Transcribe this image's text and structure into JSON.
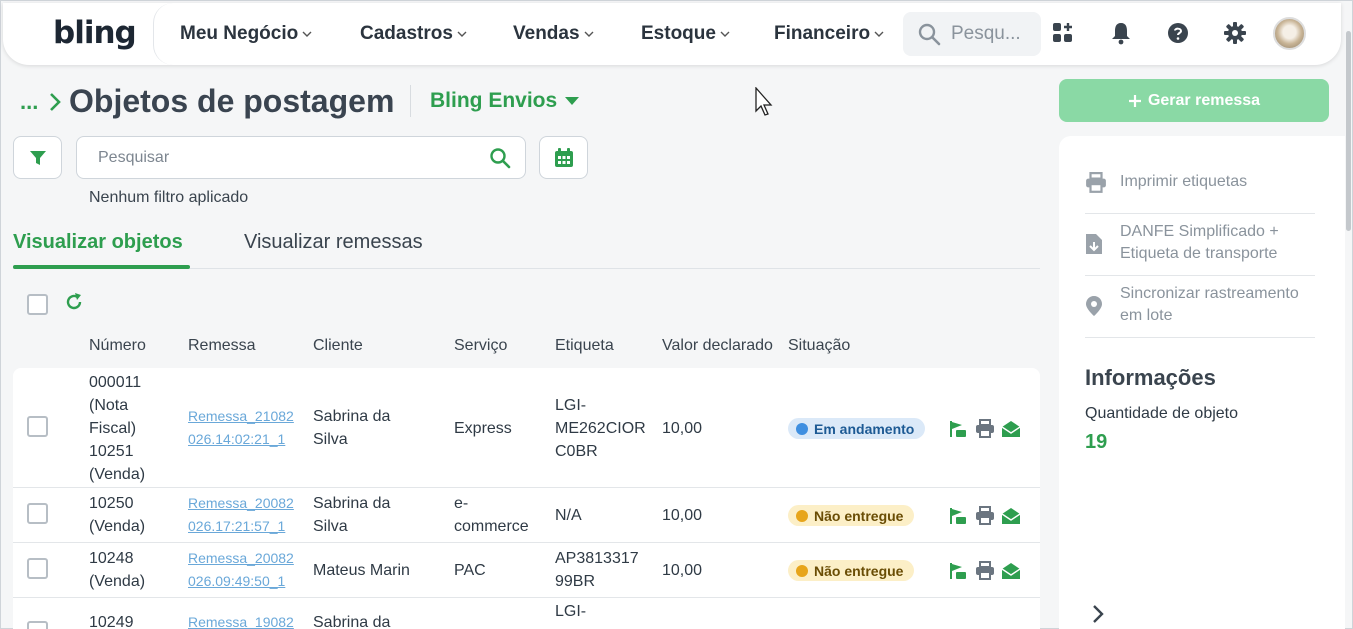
{
  "nav": {
    "logo": "bling",
    "items": [
      "Meu Negócio",
      "Cadastros",
      "Vendas",
      "Estoque",
      "Financeiro"
    ],
    "search_placeholder": "Pesqu..."
  },
  "header": {
    "breadcrumb": "...",
    "title": "Objetos de postagem",
    "module": "Bling Envios"
  },
  "filters": {
    "search_placeholder": "Pesquisar",
    "status": "Nenhum filtro aplicado"
  },
  "tabs": [
    "Visualizar objetos",
    "Visualizar remessas"
  ],
  "table": {
    "columns": [
      "Número",
      "Remessa",
      "Cliente",
      "Serviço",
      "Etiqueta",
      "Valor declarado",
      "Situação"
    ],
    "rows": [
      {
        "numero": [
          "000011",
          "(Nota",
          "Fiscal)",
          "10251",
          "(Venda)"
        ],
        "remessa": [
          "Remessa_21082",
          "026.14:02:21_1"
        ],
        "cliente": [
          "Sabrina da",
          "Silva"
        ],
        "servico": [
          "Express"
        ],
        "etiqueta": [
          "LGI-",
          "ME262CIOR",
          "C0BR"
        ],
        "valor": "10,00",
        "situacao": "Em andamento"
      },
      {
        "numero": [
          "10250",
          "(Venda)"
        ],
        "remessa": [
          "Remessa_20082",
          "026.17:21:57_1"
        ],
        "cliente": [
          "Sabrina da",
          "Silva"
        ],
        "servico": [
          "e-",
          "commerce"
        ],
        "etiqueta": [
          "N/A"
        ],
        "valor": "10,00",
        "situacao": "Não entregue"
      },
      {
        "numero": [
          "10248",
          "(Venda)"
        ],
        "remessa": [
          "Remessa_20082",
          "026.09:49:50_1"
        ],
        "cliente": [
          "Mateus Marin"
        ],
        "servico": [
          "PAC"
        ],
        "etiqueta": [
          "AP3813317",
          "99BR"
        ],
        "valor": "10,00",
        "situacao": "Não entregue"
      },
      {
        "numero": [
          "10249"
        ],
        "remessa": [
          "Remessa_19082"
        ],
        "cliente": [
          "Sabrina da"
        ],
        "servico": [],
        "etiqueta": [
          "LGI-"
        ],
        "valor": "",
        "situacao": ""
      }
    ]
  },
  "panel": {
    "generate_button": "Gerar remessa",
    "actions": [
      "Imprimir etiquetas",
      "DANFE Simplificado + Etiqueta de transporte",
      "Sincronizar rastreamento em lote"
    ],
    "info_title": "Informações",
    "info_label": "Quantidade de objeto",
    "info_value": "19"
  },
  "colors": {
    "brand_green": "#2e9e4f",
    "status_blue": "#3f8fe0",
    "status_yellow": "#e7a51b"
  }
}
